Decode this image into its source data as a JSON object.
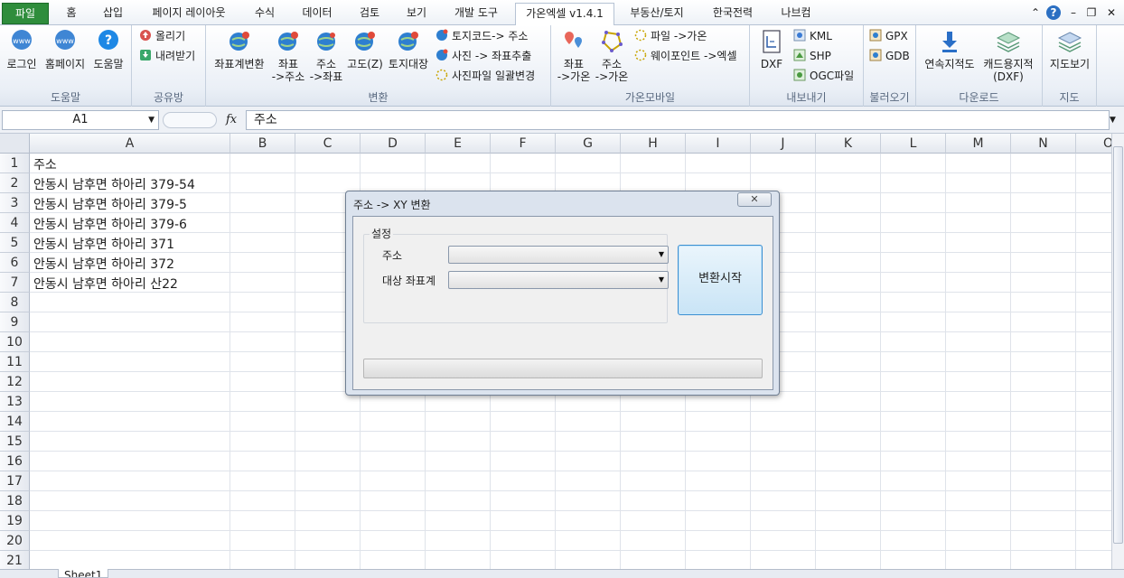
{
  "tabs": [
    "파일",
    "홈",
    "삽입",
    "페이지 레이아웃",
    "수식",
    "데이터",
    "검토",
    "보기",
    "개발 도구",
    "가온엑셀 v1.4.1",
    "부동산/토지",
    "한국전력",
    "나브컴"
  ],
  "ribbon": {
    "group_help": {
      "name": "도움말",
      "login": "로그인",
      "homepage": "홈페이지",
      "help": "도움말"
    },
    "group_share": {
      "name": "공유방",
      "upload": "올리기",
      "download": "내려받기"
    },
    "group_convert": {
      "name": "변환",
      "coord_convert": "좌표계변환",
      "coord_to_addr_1": "좌표",
      "coord_to_addr_2": "->주소",
      "addr_to_coord_1": "주소",
      "addr_to_coord_2": "->좌표",
      "altitude": "고도(Z)",
      "land_ledger": "토지대장",
      "landcode_to_addr": "토지코드-> 주소",
      "photo_extract": "사진 -> 좌표추출",
      "photo_rename": "사진파일 일괄변경"
    },
    "group_mobile": {
      "name": "가온모바일",
      "coord_gaon_1": "좌표",
      "coord_gaon_2": "->가온",
      "addr_gaon_1": "주소",
      "addr_gaon_2": "->가온",
      "file_gaon": "파일 ->가온",
      "waypoint_excel": "웨이포인트 ->엑셀"
    },
    "group_export": {
      "name": "내보내기",
      "dxf": "DXF",
      "kml": "KML",
      "shp": "SHP",
      "ogc": "OGC파일"
    },
    "group_import": {
      "name": "불러오기",
      "gpx": "GPX",
      "gdb": "GDB"
    },
    "group_download": {
      "name": "다운로드",
      "cont_map": "연속지적도",
      "cad_map_1": "캐드용지적",
      "cad_map_2": "(DXF)"
    },
    "group_map": {
      "name": "지도",
      "view_map": "지도보기"
    }
  },
  "formula_bar": {
    "name_box": "A1",
    "fx": "fx",
    "content": "주소"
  },
  "columns": [
    "A",
    "B",
    "C",
    "D",
    "E",
    "F",
    "G",
    "H",
    "I",
    "J",
    "K",
    "L",
    "M",
    "N",
    "O"
  ],
  "rows": [
    "1",
    "2",
    "3",
    "4",
    "5",
    "6",
    "7",
    "8",
    "9",
    "10",
    "11",
    "12",
    "13",
    "14",
    "15",
    "16",
    "17",
    "18",
    "19",
    "20",
    "21"
  ],
  "cells": [
    "주소",
    "안동시 남후면 하아리 379-54",
    "안동시 남후면 하아리 379-5",
    "안동시 남후면 하아리 379-6",
    "안동시 남후면 하아리 371",
    "안동시 남후면 하아리 372",
    "안동시 남후면 하아리 산22"
  ],
  "sheet_tab": "Sheet1",
  "dialog": {
    "title": "주소 -> XY 변환",
    "close": "✕",
    "group_label": "설정",
    "address_label": "주소",
    "target_crs_label": "대상 좌표계",
    "address_value": "",
    "target_crs_value": "",
    "start_button": "변환시작",
    "progress": 0
  }
}
